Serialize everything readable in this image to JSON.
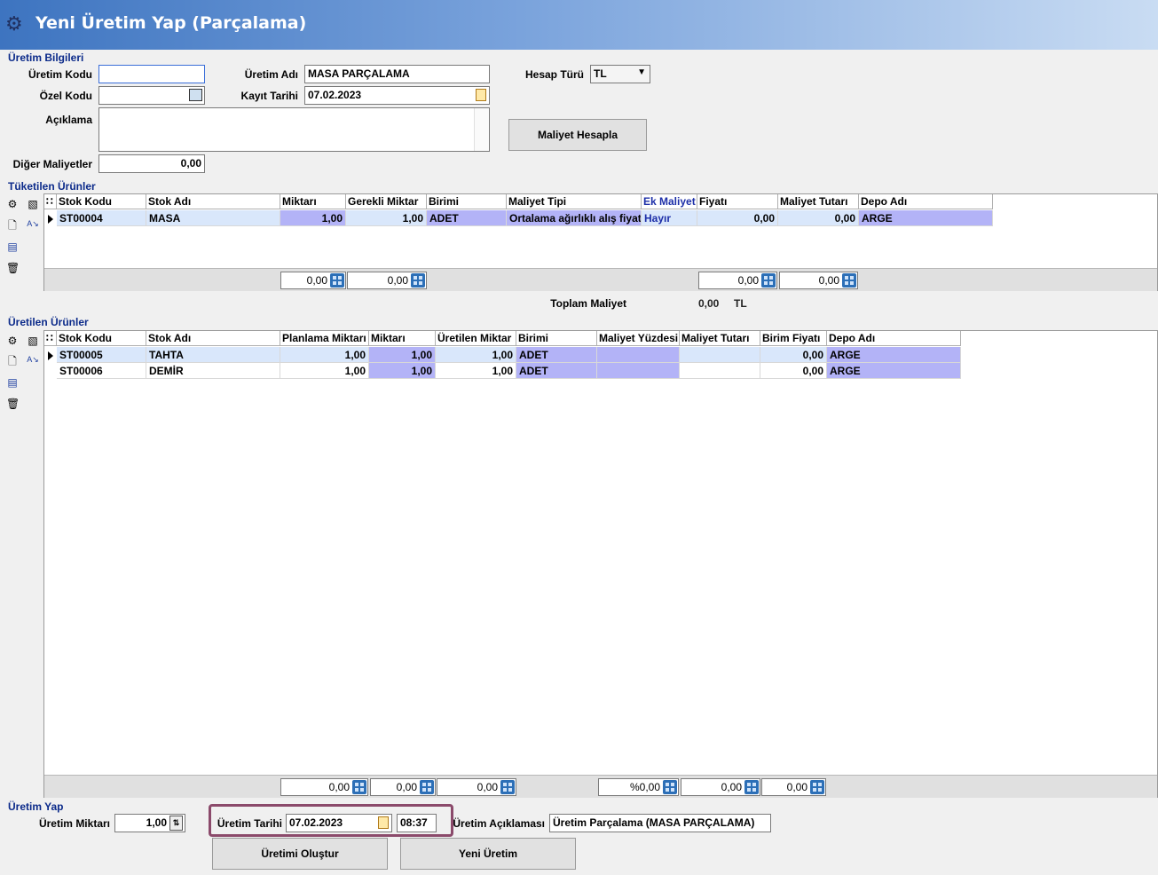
{
  "window": {
    "title": "Yeni Üretim Yap (Parçalama)"
  },
  "uretim_bilgileri": {
    "section_label": "Üretim Bilgileri",
    "uretim_kodu_label": "Üretim Kodu",
    "uretim_kodu_value": "",
    "ozel_kodu_label": "Özel Kodu",
    "ozel_kodu_value": "",
    "aciklama_label": "Açıklama",
    "aciklama_value": "",
    "diger_maliyetler_label": "Diğer Maliyetler",
    "diger_maliyetler_value": "0,00",
    "uretim_adi_label": "Üretim Adı",
    "uretim_adi_value": "MASA PARÇALAMA",
    "kayit_tarihi_label": "Kayıt Tarihi",
    "kayit_tarihi_value": "07.02.2023",
    "hesap_turu_label": "Hesap Türü",
    "hesap_turu_value": "TL",
    "maliyet_hesapla_label": "Maliyet Hesapla"
  },
  "tuketilen": {
    "section_label": "Tüketilen Ürünler",
    "columns": [
      "Stok Kodu",
      "Stok Adı",
      "Miktarı",
      "Gerekli Miktar",
      "Birimi",
      "Maliyet Tipi",
      "Ek Maliyet",
      "Fiyatı",
      "Maliyet Tutarı",
      "Depo Adı"
    ],
    "rows": [
      {
        "stok_kodu": "ST00004",
        "stok_adi": "MASA",
        "miktari": "1,00",
        "gerekli_miktar": "1,00",
        "birimi": "ADET",
        "maliyet_tipi": "Ortalama ağırlıklı alış fiyatı",
        "ek_maliyet": "Hayır",
        "fiyati": "0,00",
        "maliyet_tutari": "0,00",
        "depo_adi": "ARGE"
      }
    ],
    "footer": {
      "miktari": "0,00",
      "gerekli_miktar": "0,00",
      "fiyati": "0,00",
      "maliyet_tutari": "0,00"
    }
  },
  "toplam": {
    "label": "Toplam Maliyet",
    "value": "0,00",
    "currency": "TL"
  },
  "uretilen": {
    "section_label": "Üretilen Ürünler",
    "columns": [
      "Stok Kodu",
      "Stok Adı",
      "Planlama Miktarı",
      "Miktarı",
      "Üretilen Miktar",
      "Birimi",
      "Maliyet Yüzdesi",
      "Maliyet Tutarı",
      "Birim Fiyatı",
      "Depo Adı"
    ],
    "rows": [
      {
        "stok_kodu": "ST00005",
        "stok_adi": "TAHTA",
        "planlama": "1,00",
        "miktari": "1,00",
        "uretilen": "1,00",
        "birimi": "ADET",
        "yuzde": "",
        "tutar": "",
        "birim_fiyati": "0,00",
        "depo": "ARGE"
      },
      {
        "stok_kodu": "ST00006",
        "stok_adi": "DEMİR",
        "planlama": "1,00",
        "miktari": "1,00",
        "uretilen": "1,00",
        "birimi": "ADET",
        "yuzde": "",
        "tutar": "",
        "birim_fiyati": "0,00",
        "depo": "ARGE"
      }
    ],
    "footer": {
      "planlama": "0,00",
      "miktari": "0,00",
      "uretilen": "0,00",
      "yuzde": "%0,00",
      "tutar": "0,00",
      "birim_fiyati": "0,00"
    }
  },
  "uretim_yap": {
    "section_label": "Üretim Yap",
    "miktari_label": "Üretim Miktarı",
    "miktari_value": "1,00",
    "tarihi_label": "Üretim Tarihi",
    "tarihi_value": "07.02.2023",
    "saat_value": "08:37",
    "aciklama_label": "Üretim Açıklaması",
    "aciklama_value": "Üretim Parçalama (MASA PARÇALAMA)",
    "olustur_label": "Üretimi Oluştur",
    "yeni_label": "Yeni Üretim"
  },
  "colors": {
    "highlight": "#8b4a6b",
    "purple": "#b3b3f7",
    "selected": "#d9e7fb"
  }
}
